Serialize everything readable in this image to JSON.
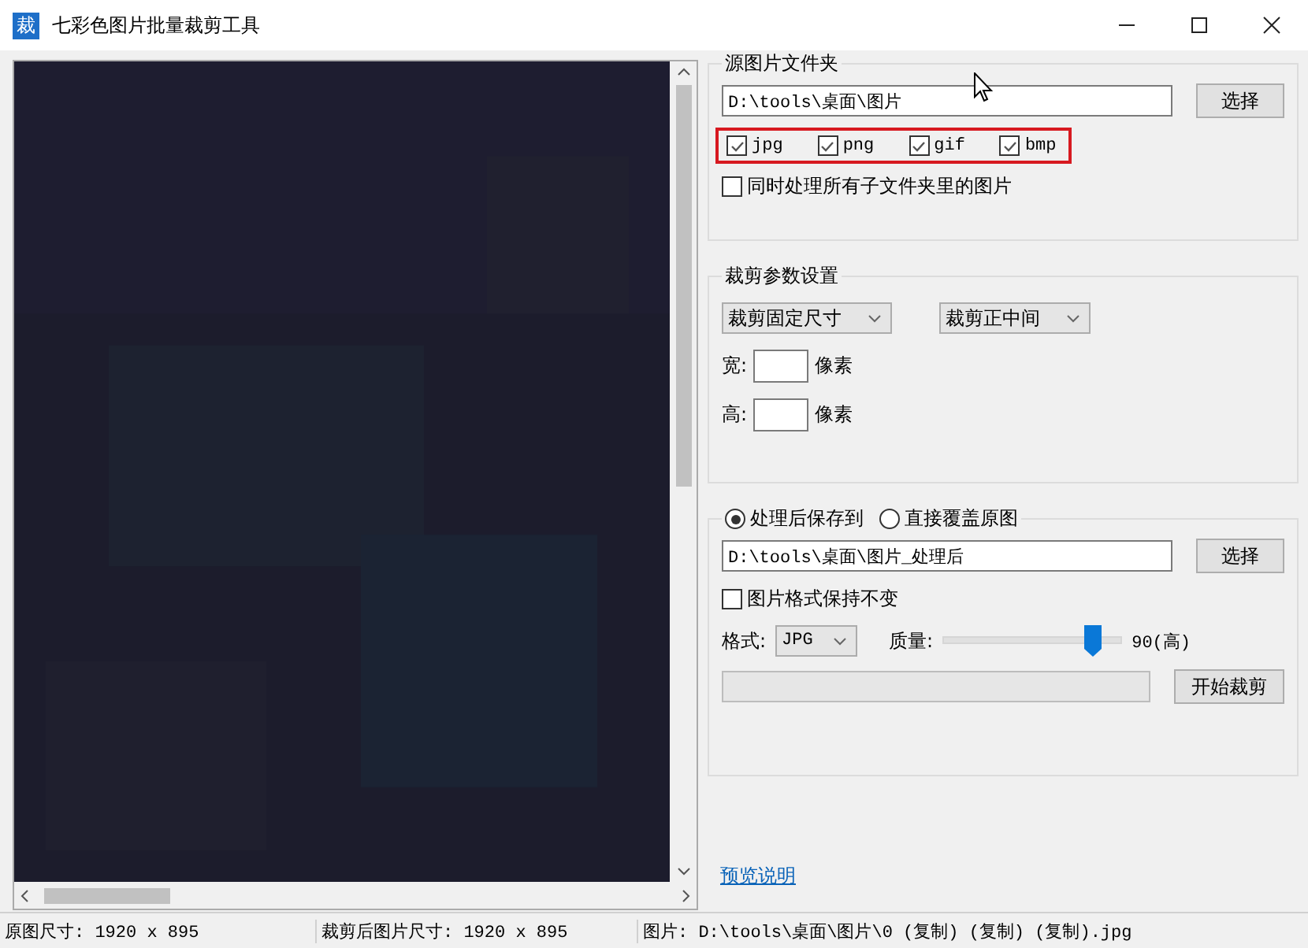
{
  "window": {
    "title": "七彩色图片批量裁剪工具",
    "app_icon": "裁"
  },
  "source": {
    "title": "源图片文件夹",
    "path": "D:\\tools\\桌面\\图片",
    "button": "选择",
    "formats": [
      {
        "label": "jpg",
        "checked": true
      },
      {
        "label": "png",
        "checked": true
      },
      {
        "label": "gif",
        "checked": true
      },
      {
        "label": "bmp",
        "checked": true
      }
    ],
    "subfolders": {
      "label": "同时处理所有子文件夹里的图片",
      "checked": false
    }
  },
  "crop": {
    "title": "裁剪参数设置",
    "mode": "裁剪固定尺寸",
    "position": "裁剪正中间",
    "fields": [
      {
        "label": "宽:",
        "unit": "像素"
      },
      {
        "label": "高:",
        "unit": "像素"
      }
    ]
  },
  "output": {
    "options": [
      {
        "label": "处理后保存到",
        "selected": true
      },
      {
        "label": "直接覆盖原图",
        "selected": false
      }
    ],
    "path": "D:\\tools\\桌面\\图片_处理后",
    "button": "选择",
    "keep_format": {
      "label": "图片格式保持不变",
      "checked": false
    },
    "format_label": "格式:",
    "format_value": "JPG",
    "quality_label": "质量:",
    "quality": {
      "level": 0.83
    },
    "quality_reading": "90(高)",
    "progress": {
      "level": 0
    },
    "start_button": "开始裁剪"
  },
  "help_link": "预览说明",
  "status_bar": [
    "原图尺寸: 1920 x 895",
    "裁剪后图片尺寸: 1920 x 895",
    "图片: D:\\tools\\桌面\\图片\\0 (复制) (复制) (复制).jpg"
  ]
}
